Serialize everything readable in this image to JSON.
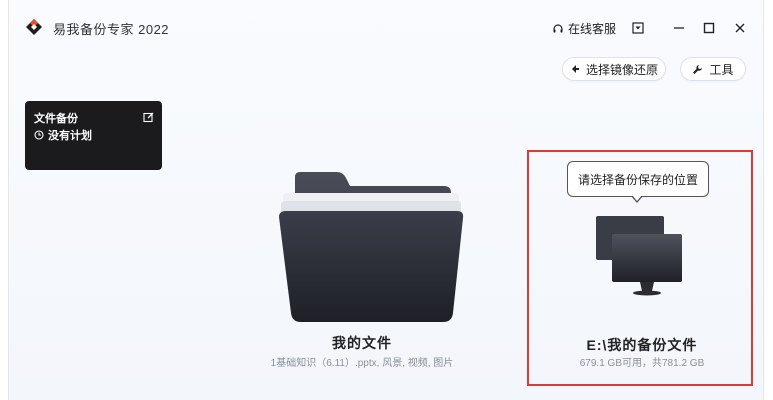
{
  "window": {
    "title": "易我备份专家 2022",
    "support_label": "在线客服",
    "colors": {
      "accent_red": "#d93a3a",
      "card_bg": "#1b1b1d"
    }
  },
  "toolbar": {
    "restore_image_label": "选择镜像还原",
    "tools_label": "工具"
  },
  "task": {
    "title": "文件备份",
    "schedule": "没有计划"
  },
  "source": {
    "title": "我的文件",
    "subtitle": "1基础知识（6.11）.pptx, 风景, 视频, 图片"
  },
  "destination": {
    "prompt": "请选择备份保存的位置",
    "title": "E:\\我的备份文件",
    "subtitle": "679.1 GB可用，共781.2 GB"
  },
  "icons": [
    "app-logo-icon",
    "headset-icon",
    "dropdown-menu-icon",
    "minimize-icon",
    "maximize-icon",
    "close-icon",
    "back-arrow-icon",
    "wrench-icon",
    "edit-icon",
    "clock-icon",
    "folder-icon",
    "computer-icon"
  ]
}
